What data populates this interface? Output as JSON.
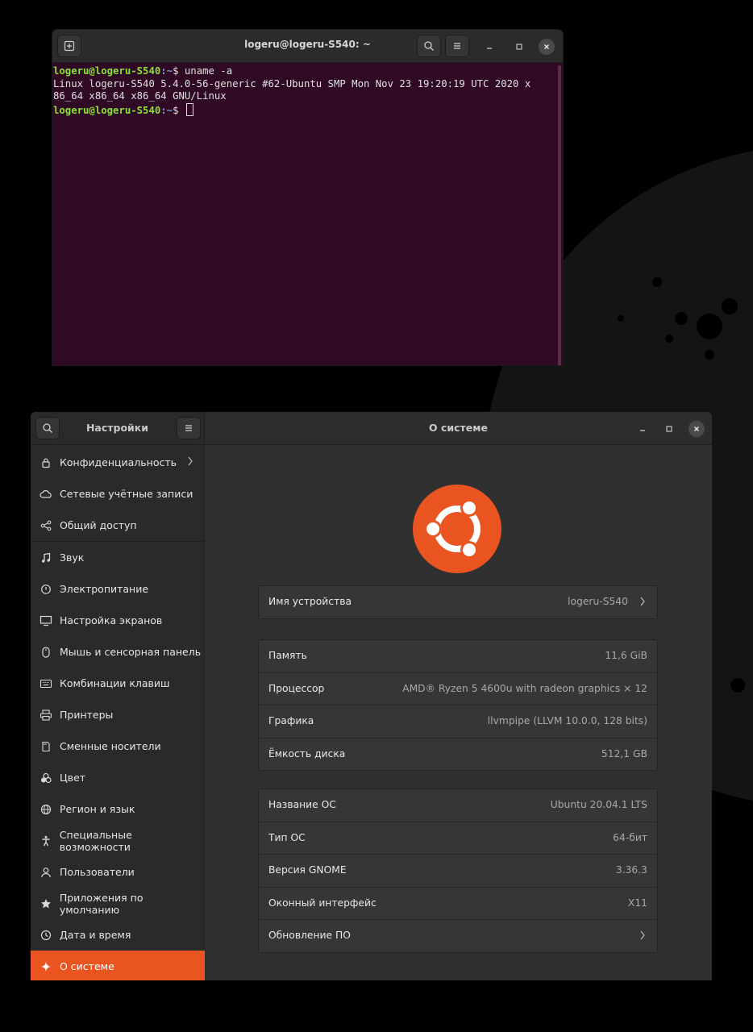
{
  "terminal": {
    "title": "logeru@logeru-S540: ~",
    "prompt_user": "logeru@logeru-S540",
    "prompt_path": ":~",
    "prompt_symbol": "$ ",
    "command": "uname -a",
    "output_line_1": "Linux logeru-S540 5.4.0-56-generic #62-Ubuntu SMP Mon Nov 23 19:20:19 UTC 2020 x",
    "output_line_2": "86_64 x86_64 x86_64 GNU/Linux"
  },
  "settings": {
    "sidebar_title": "Настройки",
    "main_title": "О системе",
    "sidebar_items": [
      {
        "label": "Конфиденциальность",
        "icon": "lock-icon"
      },
      {
        "label": "Сетевые учётные записи",
        "icon": "cloud-icon"
      },
      {
        "label": "Общий доступ",
        "icon": "share-icon"
      },
      {
        "label": "Звук",
        "icon": "music-note-icon"
      },
      {
        "label": "Электропитание",
        "icon": "power-icon"
      },
      {
        "label": "Настройка экранов",
        "icon": "display-icon"
      },
      {
        "label": "Мышь и сенсорная панель",
        "icon": "mouse-icon"
      },
      {
        "label": "Комбинации клавиш",
        "icon": "keyboard-icon"
      },
      {
        "label": "Принтеры",
        "icon": "printer-icon"
      },
      {
        "label": "Сменные носители",
        "icon": "removable-media-icon"
      },
      {
        "label": "Цвет",
        "icon": "color-icon"
      },
      {
        "label": "Регион и язык",
        "icon": "globe-icon"
      },
      {
        "label": "Специальные возможности",
        "icon": "accessibility-icon"
      },
      {
        "label": "Пользователи",
        "icon": "users-icon"
      },
      {
        "label": "Приложения по умолчанию",
        "icon": "star-icon"
      },
      {
        "label": "Дата и время",
        "icon": "clock-icon"
      },
      {
        "label": "О системе",
        "icon": "sparkle-icon"
      }
    ],
    "device": {
      "label": "Имя устройства",
      "value": "logeru-S540"
    },
    "hardware": [
      {
        "label": "Память",
        "value": "11,6 GiB"
      },
      {
        "label": "Процессор",
        "value": "AMD® Ryzen 5 4600u with radeon graphics × 12"
      },
      {
        "label": "Графика",
        "value": "llvmpipe (LLVM 10.0.0, 128 bits)"
      },
      {
        "label": "Ёмкость диска",
        "value": "512,1 GB"
      }
    ],
    "os": [
      {
        "label": "Название ОС",
        "value": "Ubuntu 20.04.1 LTS"
      },
      {
        "label": "Тип ОС",
        "value": "64-бит"
      },
      {
        "label": "Версия GNOME",
        "value": "3.36.3"
      },
      {
        "label": "Оконный интерфейс",
        "value": "X11"
      },
      {
        "label": "Обновление ПО",
        "value": ""
      }
    ]
  },
  "colors": {
    "accent": "#e95420",
    "terminal_bg": "#300a24",
    "prompt_user": "#8ae234",
    "prompt_path": "#729fcf"
  }
}
